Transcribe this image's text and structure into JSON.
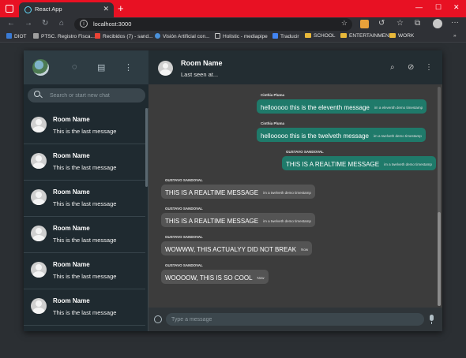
{
  "browser": {
    "tab_title": "React App",
    "tab_close": "✕",
    "new_tab": "+",
    "url": "localhost:3000",
    "bookmarks": [
      {
        "label": "DIOT",
        "icon": "blue-square"
      },
      {
        "label": "PTSC. Registro Fisca...",
        "icon": "bank"
      },
      {
        "label": "Recibidos (7) - sand...",
        "icon": "gmail"
      },
      {
        "label": "Visión Artificial con...",
        "icon": "person"
      },
      {
        "label": "Holistic - mediapipe",
        "icon": "page"
      },
      {
        "label": "Traducir",
        "icon": "translate"
      },
      {
        "label": "SCHOOL",
        "icon": "folder"
      },
      {
        "label": "ENTERTAINMENT",
        "icon": "folder"
      },
      {
        "label": "WORK",
        "icon": "folder"
      }
    ],
    "accent_color": "#e81123"
  },
  "sidebar": {
    "search_placeholder": "Search or start new chat",
    "rooms": [
      {
        "name": "Room Name",
        "last": "This is the last message"
      },
      {
        "name": "Room Name",
        "last": "This is the last message"
      },
      {
        "name": "Room Name",
        "last": "This is the last message"
      },
      {
        "name": "Room Name",
        "last": "This is the last message"
      },
      {
        "name": "Room Name",
        "last": "This is the last message"
      },
      {
        "name": "Room Name",
        "last": "This is the last message"
      }
    ]
  },
  "chat": {
    "room_name": "Room Name",
    "last_seen": "Last seen at...",
    "input_placeholder": "Type a message",
    "messages": [
      {
        "sender": "Cinthia Pluma",
        "text": "hellooooo this is the eleventh message",
        "time": "im a eleventh demo timestamp",
        "own": true
      },
      {
        "sender": "Cinthia Pluma",
        "text": "hellooooo this is the twelveth message",
        "time": "im a twelveth demo timestamp",
        "own": true
      },
      {
        "sender": "GUSTAVO SANDOVAL",
        "text": "THIS IS A REALTIME MESSAGE",
        "time": "im a twelveth demo timestamp",
        "own": true
      },
      {
        "sender": "GUSTAVO SANDOVAL",
        "text": "THIS IS A REALTIME MESSAGE",
        "time": "im a twelveth demo timestamp",
        "own": false
      },
      {
        "sender": "GUSTAVO SANDOVAL",
        "text": "THIS IS A REALTIME MESSAGE",
        "time": "im a twelveth demo timestamp",
        "own": false
      },
      {
        "sender": "GUSTAVO SANDOVAL",
        "text": "WOWWW, THIS ACTUALYY DID NOT BREAK",
        "time": "Now",
        "own": false
      },
      {
        "sender": "GUSTAVO SANDOVAL",
        "text": "WOOOOW, THIS IS SO COOL",
        "time": "Now",
        "own": false
      }
    ]
  }
}
